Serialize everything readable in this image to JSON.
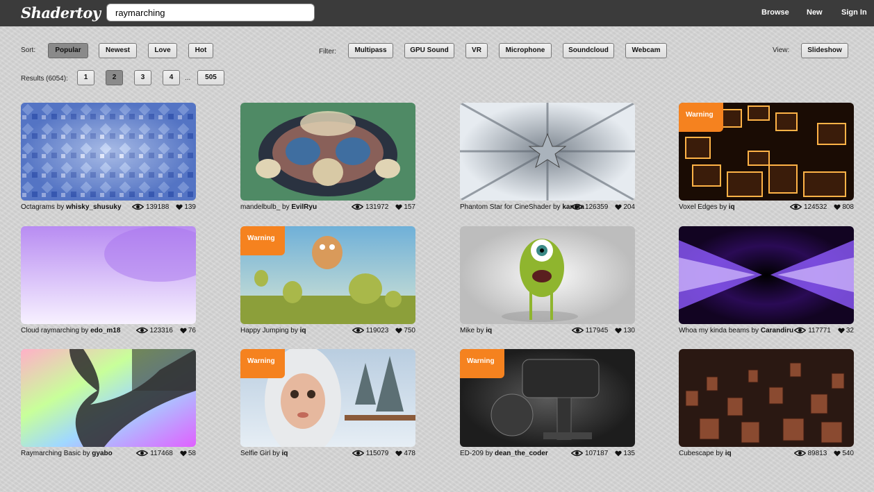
{
  "header": {
    "logo": "Shadertoy",
    "search_value": "raymarching",
    "nav": [
      "Browse",
      "New",
      "Sign In"
    ]
  },
  "toolbar": {
    "sort_label": "Sort:",
    "sort": [
      "Popular",
      "Newest",
      "Love",
      "Hot"
    ],
    "active_sort": "Popular",
    "filter_label": "Filter:",
    "filters": [
      "Multipass",
      "GPU Sound",
      "VR",
      "Microphone",
      "Soundcloud",
      "Webcam"
    ],
    "view_label": "View:",
    "view": "Slideshow"
  },
  "pagination": {
    "results_label": "Results (6054):",
    "pages": [
      "1",
      "2",
      "3",
      "4"
    ],
    "current": "2",
    "ellipsis": "...",
    "last": "505"
  },
  "warning_label": "Warning",
  "colors": {
    "topbar": "#3b3b3b",
    "warning": "#f5821f"
  },
  "shaders": [
    {
      "title": "Octagrams",
      "author": "whisky_shusuky",
      "views": "139188",
      "likes": "139",
      "warning": false,
      "art": "octagrams"
    },
    {
      "title": "mandelbulb_",
      "author": "EvilRyu",
      "views": "131972",
      "likes": "157",
      "warning": false,
      "art": "mandelbulb"
    },
    {
      "title": "Phantom Star for CineShader",
      "author": "kaneta",
      "views": "126359",
      "likes": "204",
      "warning": false,
      "art": "phantom"
    },
    {
      "title": "Voxel Edges",
      "author": "iq",
      "views": "124532",
      "likes": "808",
      "warning": true,
      "art": "voxel"
    },
    {
      "title": "Cloud raymarching",
      "author": "edo_m18",
      "views": "123316",
      "likes": "76",
      "warning": false,
      "art": "cloud"
    },
    {
      "title": "Happy Jumping",
      "author": "iq",
      "views": "119023",
      "likes": "750",
      "warning": true,
      "art": "happy"
    },
    {
      "title": "Mike",
      "author": "iq",
      "views": "117945",
      "likes": "130",
      "warning": false,
      "art": "mike"
    },
    {
      "title": "Whoa my kinda beams",
      "author": "Carandiru",
      "views": "117771",
      "likes": "32",
      "warning": false,
      "art": "beams"
    },
    {
      "title": "Raymarching Basic",
      "author": "gyabo",
      "views": "117468",
      "likes": "58",
      "warning": false,
      "art": "basic"
    },
    {
      "title": "Selfie Girl",
      "author": "iq",
      "views": "115079",
      "likes": "478",
      "warning": true,
      "art": "selfie"
    },
    {
      "title": "ED-209",
      "author": "dean_the_coder",
      "views": "107187",
      "likes": "135",
      "warning": true,
      "art": "ed209"
    },
    {
      "title": "Cubescape",
      "author": "iq",
      "views": "89813",
      "likes": "540",
      "warning": false,
      "art": "cubescape"
    }
  ]
}
